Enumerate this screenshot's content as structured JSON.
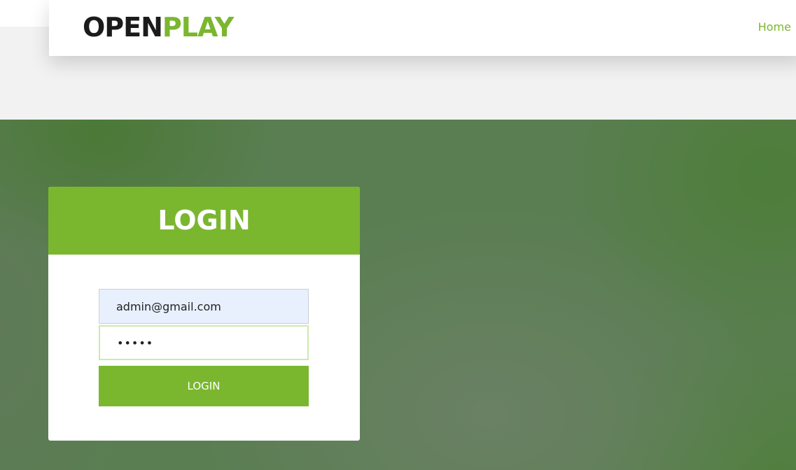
{
  "header": {
    "logo_part1": "OPEN",
    "logo_part2": "PLAY",
    "nav_home": "Home"
  },
  "login": {
    "title": "LOGIN",
    "email_value": "admin@gmail.com",
    "password_value": "•••••",
    "button_label": "LOGIN"
  },
  "colors": {
    "brand_green": "#7ab72f",
    "logo_dark": "#1b1b1b",
    "hero_green": "#5a7e52",
    "autofill_blue": "#e8f0fe"
  }
}
